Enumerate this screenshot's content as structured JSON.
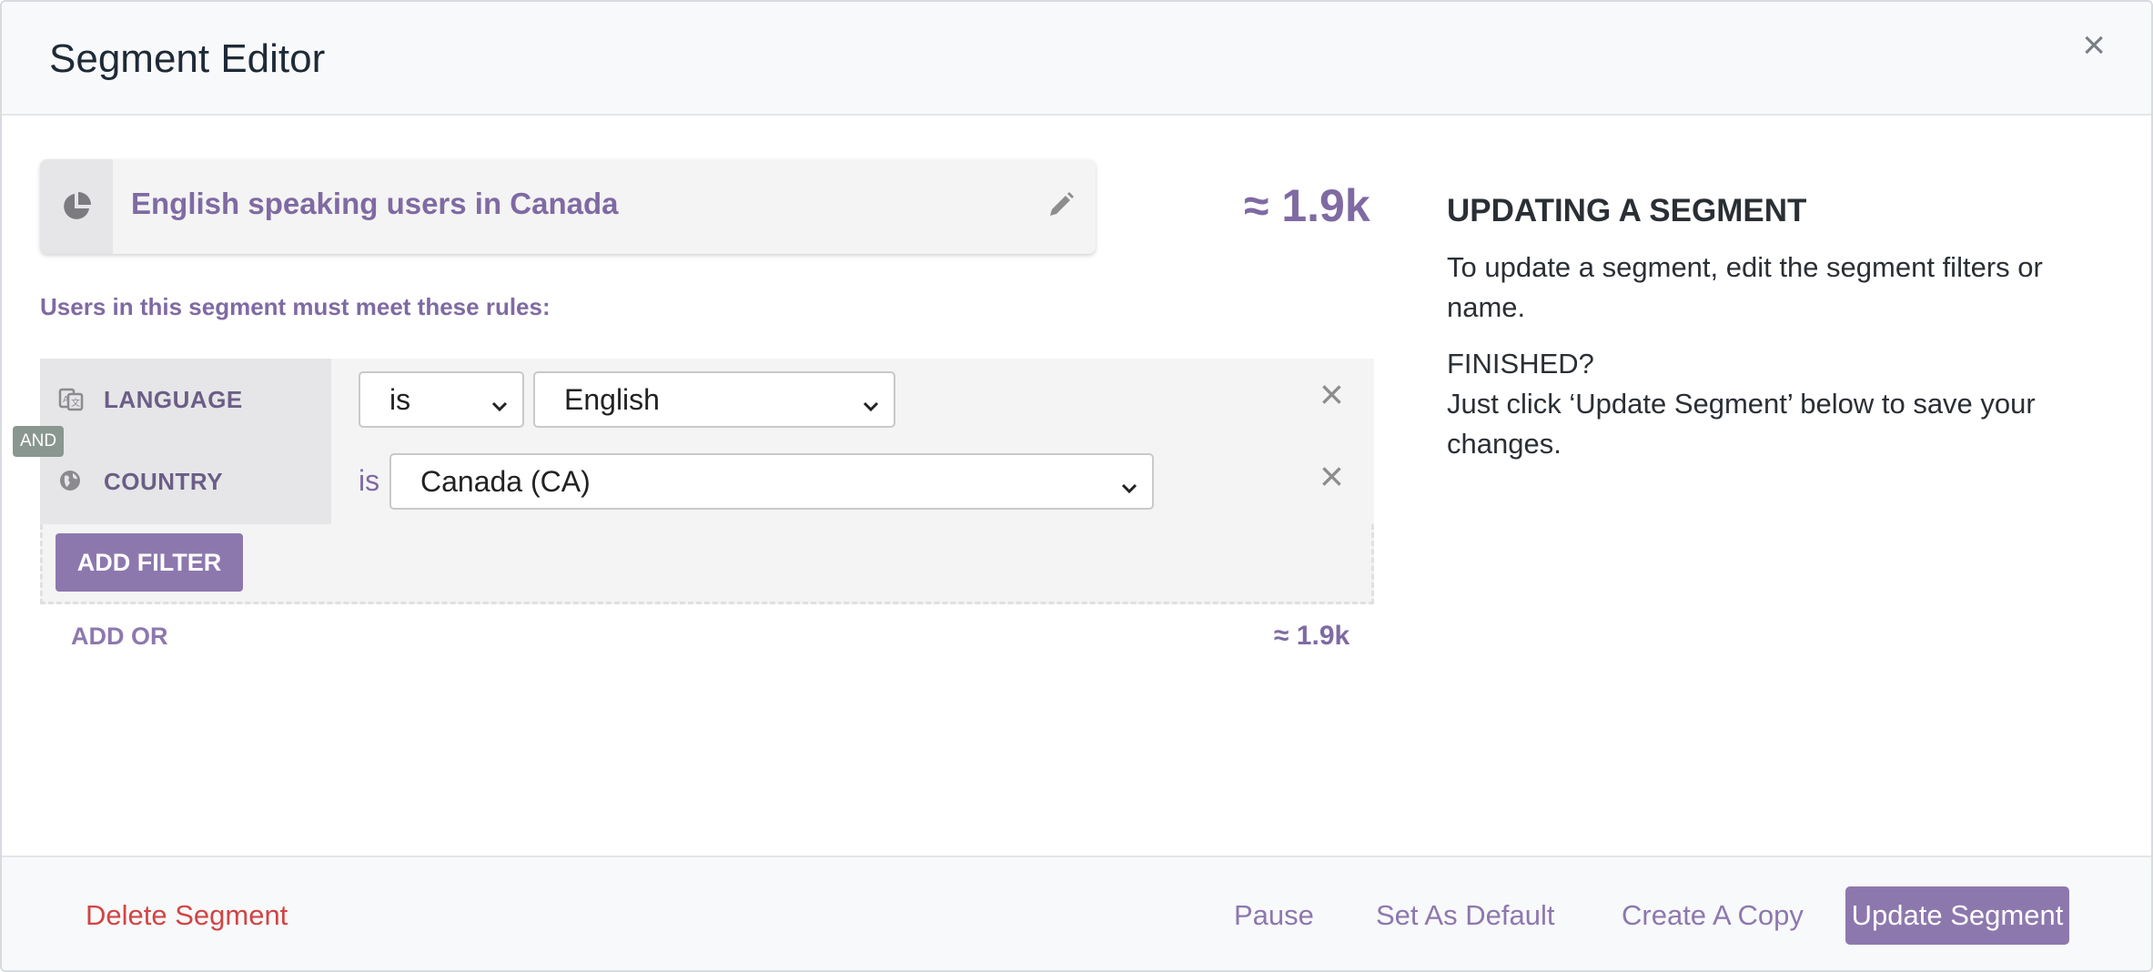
{
  "modal": {
    "title": "Segment Editor",
    "close_glyph": "×"
  },
  "segment": {
    "name": "English speaking users in Canada",
    "count": "≈ 1.9k"
  },
  "rules_label": "Users in this segment must meet these rules:",
  "filters": [
    {
      "label": "LANGUAGE",
      "operator": "is",
      "value": "English",
      "icon": "language-icon"
    },
    {
      "label": "COUNTRY",
      "operator": "is",
      "value": "Canada (CA)",
      "icon": "globe-icon"
    }
  ],
  "and_badge": "AND",
  "add_filter_label": "ADD FILTER",
  "add_or_label": "ADD OR",
  "rules_count": "≈ 1.9k",
  "help": {
    "title": "UPDATING A SEGMENT",
    "p1": "To update a segment, edit the segment filters or name.",
    "p2a": "FINISHED?",
    "p2b": "Just click ‘Update Segment’ below to save your changes."
  },
  "footer": {
    "delete": "Delete Segment",
    "pause": "Pause",
    "set_default": "Set As Default",
    "copy": "Create A Copy",
    "update": "Update Segment"
  },
  "colors": {
    "accent": "#8d78ae",
    "danger": "#d14545",
    "and_badge": "#8a9690"
  }
}
